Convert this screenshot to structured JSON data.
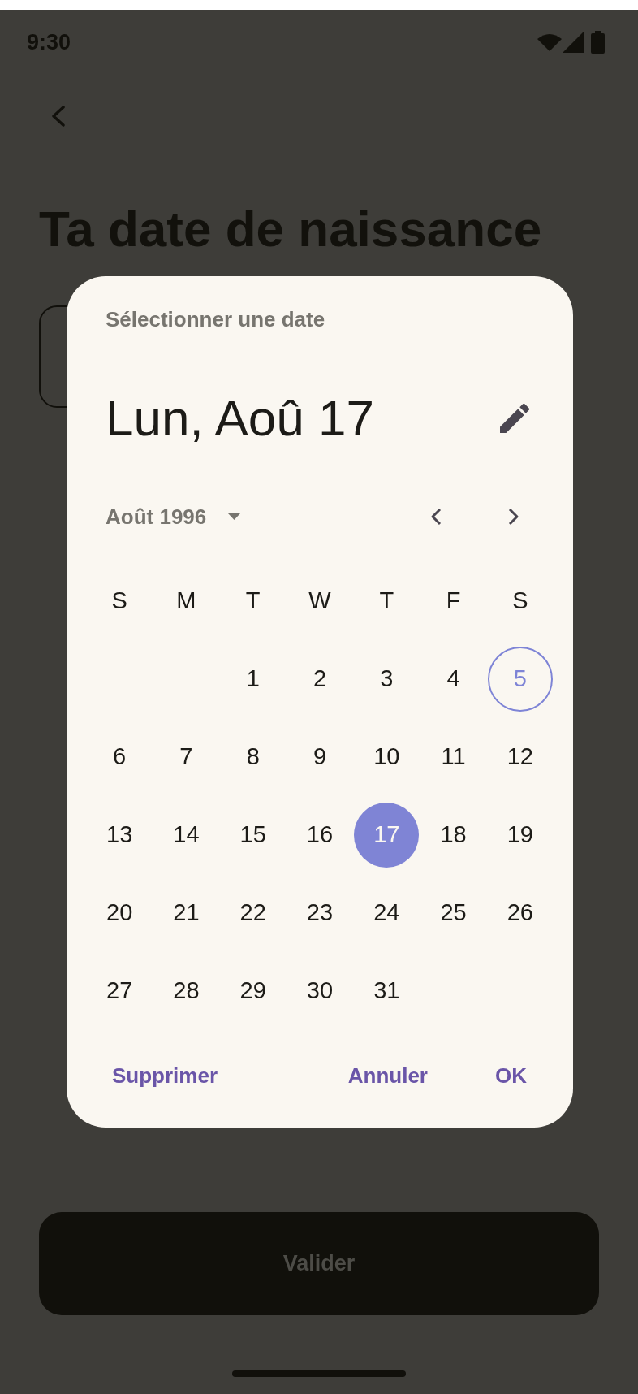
{
  "status_bar": {
    "time": "9:30"
  },
  "header": {
    "title": "Ta date de naissance"
  },
  "date_picker": {
    "headline": "Sélectionner une date",
    "selected_date": "Lun, Aoû 17",
    "month_year": "Août 1996",
    "weekdays": [
      "S",
      "M",
      "T",
      "W",
      "T",
      "F",
      "S"
    ],
    "weeks": [
      [
        {
          "label": "1",
          "selected": false,
          "today": false
        },
        {
          "label": "2",
          "selected": false,
          "today": false
        },
        {
          "label": "3",
          "selected": false,
          "today": false
        },
        {
          "label": "4",
          "selected": false,
          "today": false
        },
        {
          "label": "5",
          "selected": false,
          "today": true
        }
      ],
      [
        {
          "label": "6",
          "selected": false,
          "today": false
        },
        {
          "label": "7",
          "selected": false,
          "today": false
        },
        {
          "label": "8",
          "selected": false,
          "today": false
        },
        {
          "label": "9",
          "selected": false,
          "today": false
        },
        {
          "label": "10",
          "selected": false,
          "today": false
        },
        {
          "label": "11",
          "selected": false,
          "today": false
        },
        {
          "label": "12",
          "selected": false,
          "today": false
        }
      ],
      [
        {
          "label": "13",
          "selected": false,
          "today": false
        },
        {
          "label": "14",
          "selected": false,
          "today": false
        },
        {
          "label": "15",
          "selected": false,
          "today": false
        },
        {
          "label": "16",
          "selected": false,
          "today": false
        },
        {
          "label": "17",
          "selected": true,
          "today": false
        },
        {
          "label": "18",
          "selected": false,
          "today": false
        },
        {
          "label": "19",
          "selected": false,
          "today": false
        }
      ],
      [
        {
          "label": "20",
          "selected": false,
          "today": false
        },
        {
          "label": "21",
          "selected": false,
          "today": false
        },
        {
          "label": "22",
          "selected": false,
          "today": false
        },
        {
          "label": "23",
          "selected": false,
          "today": false
        },
        {
          "label": "24",
          "selected": false,
          "today": false
        },
        {
          "label": "25",
          "selected": false,
          "today": false
        },
        {
          "label": "26",
          "selected": false,
          "today": false
        }
      ],
      [
        {
          "label": "27",
          "selected": false,
          "today": false
        },
        {
          "label": "28",
          "selected": false,
          "today": false
        },
        {
          "label": "29",
          "selected": false,
          "today": false
        },
        {
          "label": "30",
          "selected": false,
          "today": false
        },
        {
          "label": "31",
          "selected": false,
          "today": false
        }
      ]
    ],
    "actions": [
      "Supprimer",
      "Annuler",
      "OK"
    ]
  },
  "primary_button": {
    "label": "Valider",
    "disabled": true
  }
}
